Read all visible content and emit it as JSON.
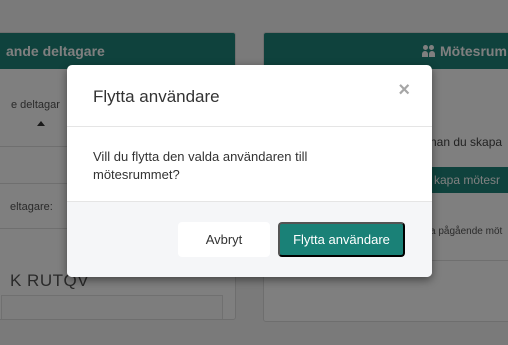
{
  "background": {
    "left_card": {
      "header": "ande deltagare",
      "field_label": "e deltagar",
      "participants_label": "eltagare:",
      "big_text": "K RUTQV"
    },
    "right_card": {
      "header": "Mötesrum",
      "hint_text": "nan du skapa",
      "create_button": "kapa mötesr",
      "ongoing_text": "a pågående möt"
    }
  },
  "modal": {
    "title": "Flytta användare",
    "close_symbol": "×",
    "body": "Vill du flytta den valda användaren till mötesrummet?",
    "cancel_label": "Avbryt",
    "confirm_label": "Flytta användare"
  },
  "colors": {
    "accent": "#1e857a",
    "primary_button": "#1a8177",
    "overlay": "rgba(0,0,0,0.5)"
  }
}
